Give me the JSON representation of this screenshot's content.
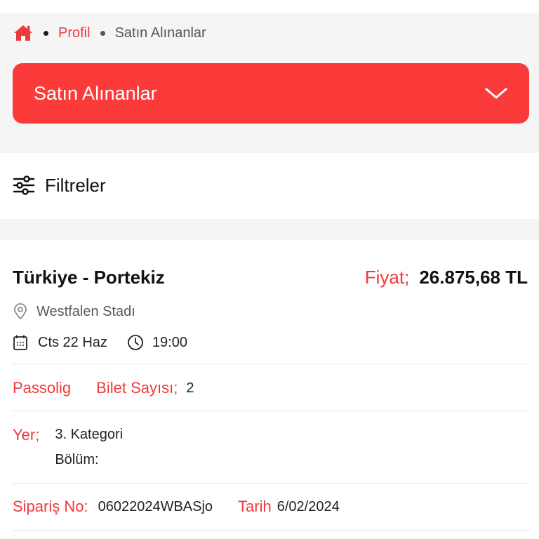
{
  "breadcrumb": {
    "profile": "Profil",
    "current": "Satın Alınanlar"
  },
  "dropdown": {
    "label": "Satın Alınanlar"
  },
  "filters": {
    "label": "Filtreler"
  },
  "order": {
    "match": "Türkiye - Portekiz",
    "price_label": "Fiyat;",
    "price_value": "26.875,68 TL",
    "venue": "Westfalen Stadı",
    "date": "Cts 22 Haz",
    "time": "19:00",
    "provider": "Passolig",
    "ticket_count_label": "Bilet Sayısı;",
    "ticket_count": "2",
    "seat_label": "Yer;",
    "category": "3. Kategori",
    "section": "Bölüm:",
    "order_no_label": "Sipariş No:",
    "order_no": "06022024WBASjo",
    "date_label": "Tarih",
    "order_date": "6/02/2024"
  },
  "colors": {
    "accent": "#fb3a3a",
    "text_red": "#f03a3a",
    "bg_gray": "#f5f5f5"
  },
  "icons": [
    "home-icon",
    "chevron-down-icon",
    "filter-sliders-icon",
    "location-pin-icon",
    "calendar-icon",
    "clock-icon"
  ]
}
